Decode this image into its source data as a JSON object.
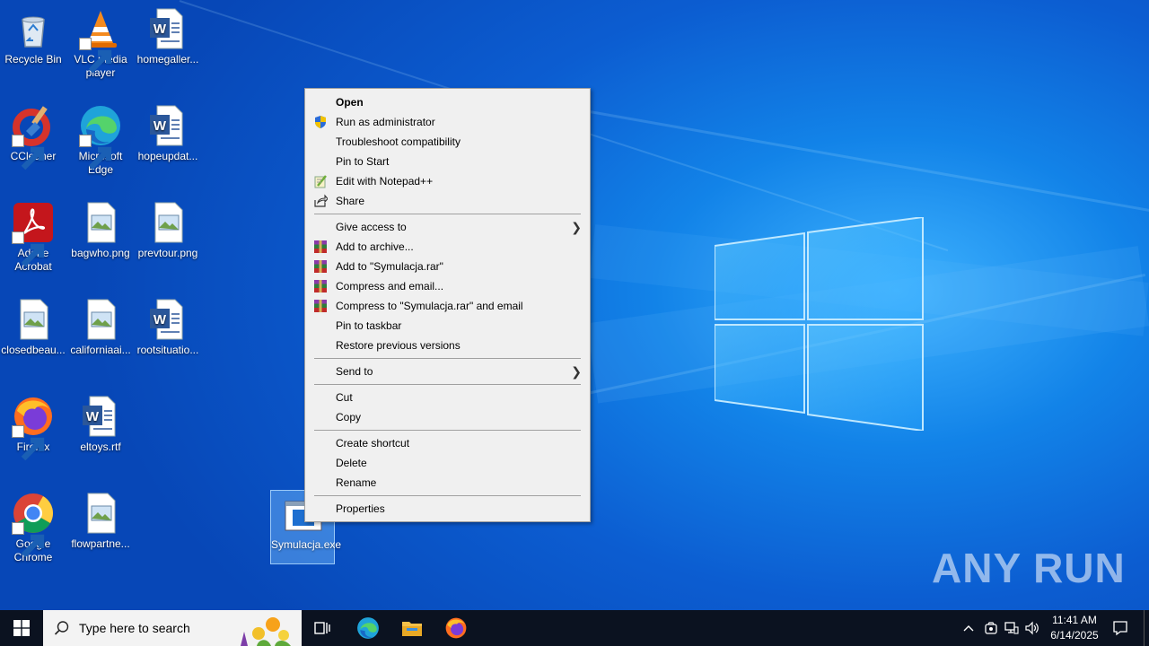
{
  "desktop": {
    "icons": [
      {
        "label": "Recycle Bin",
        "icon": "recycle-bin-icon"
      },
      {
        "label": "VLC media player",
        "icon": "vlc-icon"
      },
      {
        "label": "homegaller...",
        "icon": "word-doc-icon"
      },
      {
        "label": "CCleaner",
        "icon": "ccleaner-icon"
      },
      {
        "label": "Microsoft Edge",
        "icon": "edge-icon"
      },
      {
        "label": "hopeupdat...",
        "icon": "word-doc-icon"
      },
      {
        "label": "Adobe Acrobat",
        "icon": "acrobat-icon"
      },
      {
        "label": "bagwho.png",
        "icon": "image-file-icon"
      },
      {
        "label": "prevtour.png",
        "icon": "image-file-icon"
      },
      {
        "label": "closedbeau...",
        "icon": "image-file-icon"
      },
      {
        "label": "californiaai...",
        "icon": "image-file-icon"
      },
      {
        "label": "rootsituatio...",
        "icon": "word-doc-icon"
      },
      {
        "label": "Firefox",
        "icon": "firefox-icon"
      },
      {
        "label": "eltoys.rtf",
        "icon": "word-doc-icon"
      },
      {
        "label": "Google Chrome",
        "icon": "chrome-icon"
      },
      {
        "label": "flowpartne...",
        "icon": "image-file-icon"
      }
    ],
    "selected": {
      "label": "Symulacja.exe",
      "icon": "exe-file-icon"
    }
  },
  "context_menu": {
    "items": [
      {
        "label": "Open",
        "bold": true
      },
      {
        "label": "Run as administrator",
        "icon": "uac-shield-icon"
      },
      {
        "label": "Troubleshoot compatibility"
      },
      {
        "label": "Pin to Start"
      },
      {
        "label": "Edit with Notepad++",
        "icon": "notepadpp-icon"
      },
      {
        "label": "Share",
        "icon": "share-icon"
      },
      {
        "label": "Give access to",
        "submenu": true
      },
      {
        "label": "Add to archive...",
        "icon": "winrar-icon"
      },
      {
        "label": "Add to \"Symulacja.rar\"",
        "icon": "winrar-icon"
      },
      {
        "label": "Compress and email...",
        "icon": "winrar-icon"
      },
      {
        "label": "Compress to \"Symulacja.rar\" and email",
        "icon": "winrar-icon"
      },
      {
        "label": "Pin to taskbar"
      },
      {
        "label": "Restore previous versions"
      },
      {
        "label": "Send to",
        "submenu": true
      },
      {
        "label": "Cut"
      },
      {
        "label": "Copy"
      },
      {
        "label": "Create shortcut"
      },
      {
        "label": "Delete"
      },
      {
        "label": "Rename"
      },
      {
        "label": "Properties"
      }
    ]
  },
  "taskbar": {
    "search_placeholder": "Type here to search",
    "clock_time": "11:41 AM",
    "clock_date": "6/14/2025"
  },
  "watermark": "ANY RUN",
  "colors": {
    "desktop_blue": "#0c6fd9",
    "taskbar": "#0b1220",
    "menu_bg": "#f0f0f0"
  }
}
